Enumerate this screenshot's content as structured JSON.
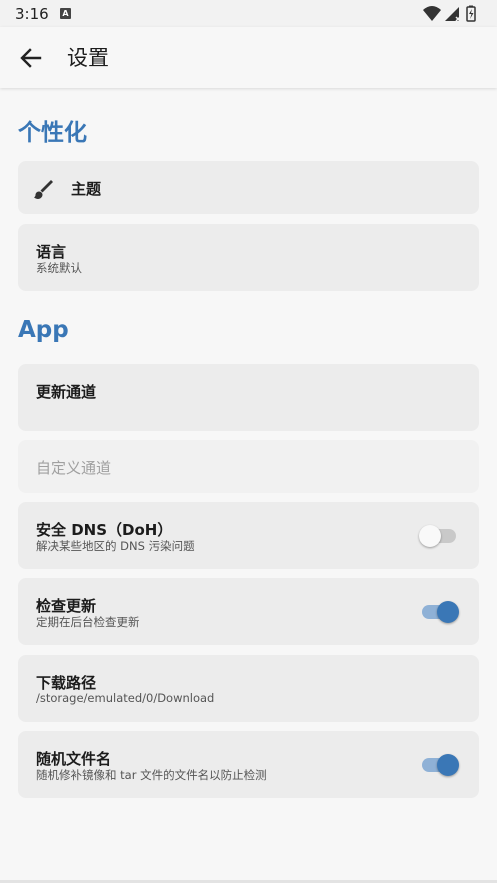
{
  "status_bar": {
    "time": "3:16",
    "notification_letter": "A"
  },
  "app_bar": {
    "title": "设置"
  },
  "sections": {
    "personalization": {
      "title": "个性化",
      "theme": {
        "label": "主题"
      },
      "language": {
        "label": "语言",
        "value": "系统默认"
      }
    },
    "app": {
      "title": "App",
      "update_channel": {
        "label": "更新通道"
      },
      "custom_channel": {
        "label": "自定义通道"
      },
      "secure_dns": {
        "label": "安全 DNS（DoH）",
        "description": "解决某些地区的 DNS 污染问题",
        "enabled": false
      },
      "check_updates": {
        "label": "检查更新",
        "description": "定期在后台检查更新",
        "enabled": true
      },
      "download_path": {
        "label": "下载路径",
        "value": "/storage/emulated/0/Download"
      },
      "random_filename": {
        "label": "随机文件名",
        "description": "随机修补镜像和 tar 文件的文件名以防止检测",
        "enabled": true
      }
    }
  },
  "colors": {
    "accent": "#3a77b6",
    "card": "#ececec",
    "background": "#f7f7f7"
  }
}
